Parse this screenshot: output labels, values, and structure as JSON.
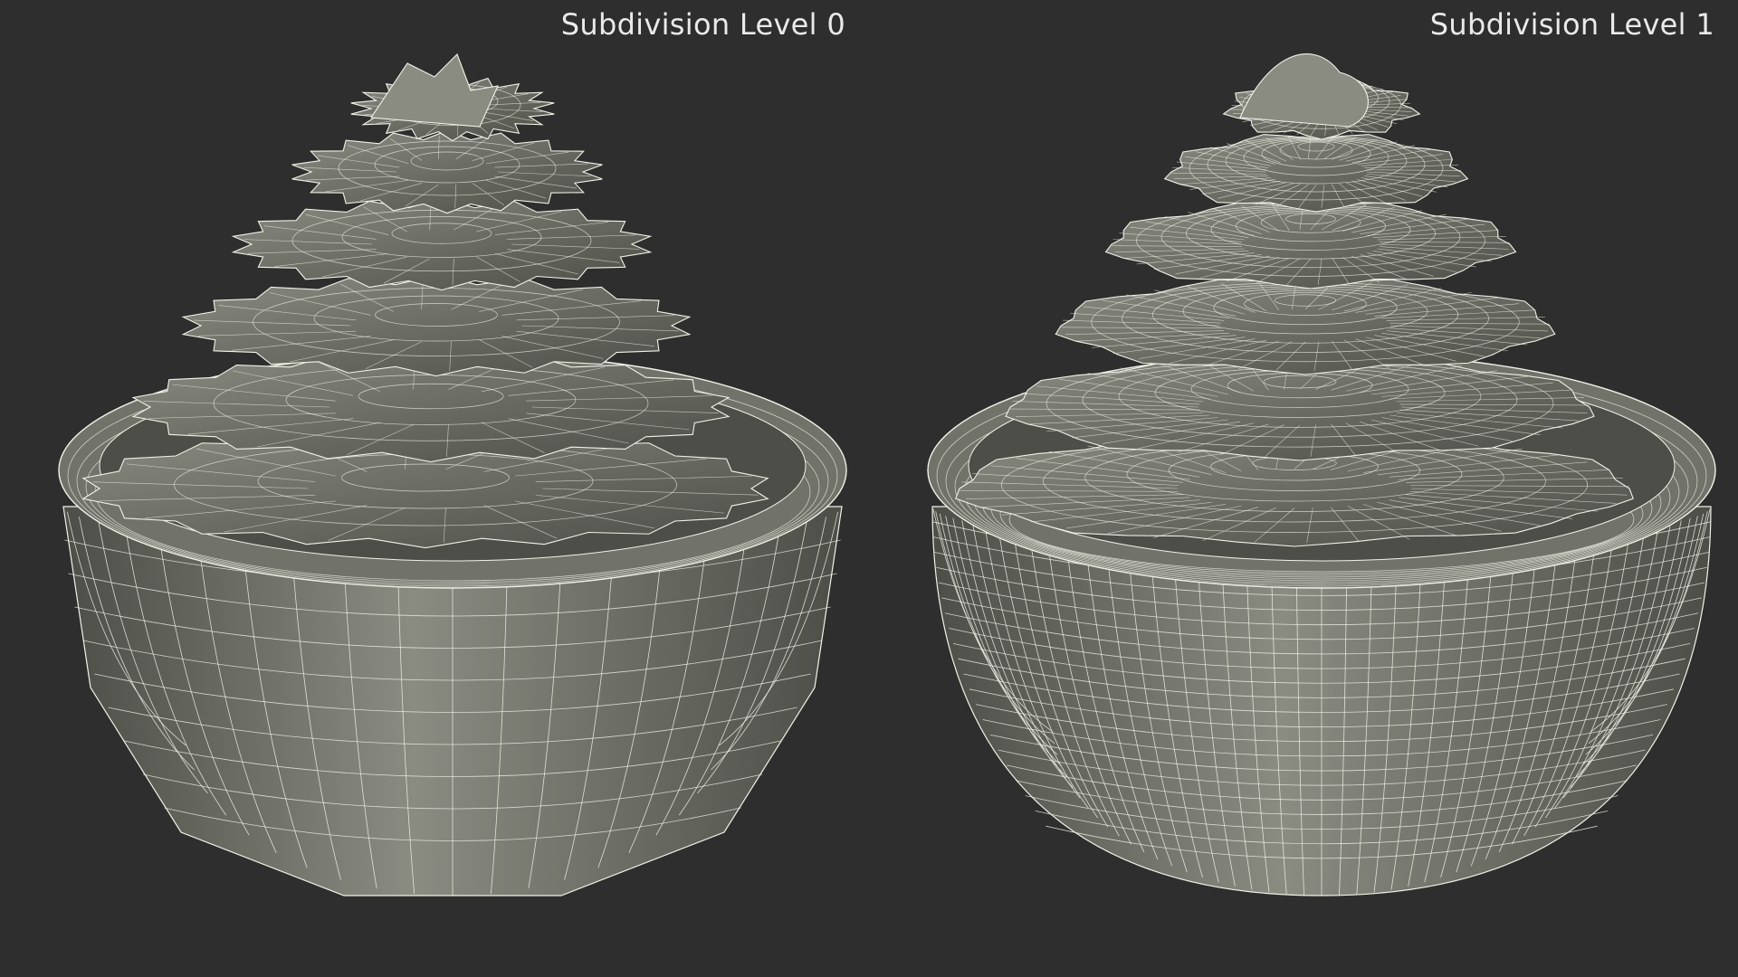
{
  "panels": [
    {
      "label": "Subdivision Level 0",
      "subdivision": 0
    },
    {
      "label": "Subdivision Level 1",
      "subdivision": 1
    }
  ],
  "colors": {
    "background": "#2e2e2e",
    "surface": "#71736a",
    "surface_light": "#8a8c82",
    "surface_dark": "#4c4e47",
    "wire": "#f2f2e8"
  }
}
